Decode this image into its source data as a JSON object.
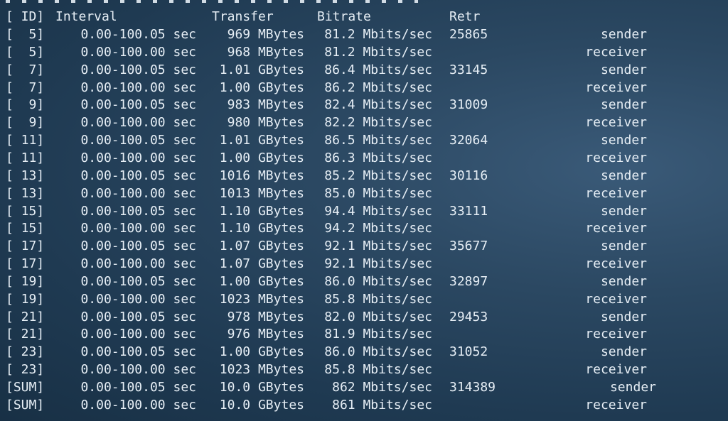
{
  "header": {
    "id": "[ ID]",
    "interval": "Interval",
    "transfer": "Transfer",
    "bitrate": "Bitrate",
    "retr": "Retr"
  },
  "rows": [
    {
      "id": "[  5]",
      "interval": "0.00-100.05 sec",
      "transfer": "969 MBytes",
      "bitrate": "81.2 Mbits/sec",
      "retr": "25865",
      "role": "sender"
    },
    {
      "id": "[  5]",
      "interval": "0.00-100.00 sec",
      "transfer": "968 MBytes",
      "bitrate": "81.2 Mbits/sec",
      "retr": "",
      "role": "receiver"
    },
    {
      "id": "[  7]",
      "interval": "0.00-100.05 sec",
      "transfer": "1.01 GBytes",
      "bitrate": "86.4 Mbits/sec",
      "retr": "33145",
      "role": "sender"
    },
    {
      "id": "[  7]",
      "interval": "0.00-100.00 sec",
      "transfer": "1.00 GBytes",
      "bitrate": "86.2 Mbits/sec",
      "retr": "",
      "role": "receiver"
    },
    {
      "id": "[  9]",
      "interval": "0.00-100.05 sec",
      "transfer": "983 MBytes",
      "bitrate": "82.4 Mbits/sec",
      "retr": "31009",
      "role": "sender"
    },
    {
      "id": "[  9]",
      "interval": "0.00-100.00 sec",
      "transfer": "980 MBytes",
      "bitrate": "82.2 Mbits/sec",
      "retr": "",
      "role": "receiver"
    },
    {
      "id": "[ 11]",
      "interval": "0.00-100.05 sec",
      "transfer": "1.01 GBytes",
      "bitrate": "86.5 Mbits/sec",
      "retr": "32064",
      "role": "sender"
    },
    {
      "id": "[ 11]",
      "interval": "0.00-100.00 sec",
      "transfer": "1.00 GBytes",
      "bitrate": "86.3 Mbits/sec",
      "retr": "",
      "role": "receiver"
    },
    {
      "id": "[ 13]",
      "interval": "0.00-100.05 sec",
      "transfer": "1016 MBytes",
      "bitrate": "85.2 Mbits/sec",
      "retr": "30116",
      "role": "sender"
    },
    {
      "id": "[ 13]",
      "interval": "0.00-100.00 sec",
      "transfer": "1013 MBytes",
      "bitrate": "85.0 Mbits/sec",
      "retr": "",
      "role": "receiver"
    },
    {
      "id": "[ 15]",
      "interval": "0.00-100.05 sec",
      "transfer": "1.10 GBytes",
      "bitrate": "94.4 Mbits/sec",
      "retr": "33111",
      "role": "sender"
    },
    {
      "id": "[ 15]",
      "interval": "0.00-100.00 sec",
      "transfer": "1.10 GBytes",
      "bitrate": "94.2 Mbits/sec",
      "retr": "",
      "role": "receiver"
    },
    {
      "id": "[ 17]",
      "interval": "0.00-100.05 sec",
      "transfer": "1.07 GBytes",
      "bitrate": "92.1 Mbits/sec",
      "retr": "35677",
      "role": "sender"
    },
    {
      "id": "[ 17]",
      "interval": "0.00-100.00 sec",
      "transfer": "1.07 GBytes",
      "bitrate": "92.1 Mbits/sec",
      "retr": "",
      "role": "receiver"
    },
    {
      "id": "[ 19]",
      "interval": "0.00-100.05 sec",
      "transfer": "1.00 GBytes",
      "bitrate": "86.0 Mbits/sec",
      "retr": "32897",
      "role": "sender"
    },
    {
      "id": "[ 19]",
      "interval": "0.00-100.00 sec",
      "transfer": "1023 MBytes",
      "bitrate": "85.8 Mbits/sec",
      "retr": "",
      "role": "receiver"
    },
    {
      "id": "[ 21]",
      "interval": "0.00-100.05 sec",
      "transfer": "978 MBytes",
      "bitrate": "82.0 Mbits/sec",
      "retr": "29453",
      "role": "sender"
    },
    {
      "id": "[ 21]",
      "interval": "0.00-100.00 sec",
      "transfer": "976 MBytes",
      "bitrate": "81.9 Mbits/sec",
      "retr": "",
      "role": "receiver"
    },
    {
      "id": "[ 23]",
      "interval": "0.00-100.05 sec",
      "transfer": "1.00 GBytes",
      "bitrate": "86.0 Mbits/sec",
      "retr": "31052",
      "role": "sender"
    },
    {
      "id": "[ 23]",
      "interval": "0.00-100.00 sec",
      "transfer": "1023 MBytes",
      "bitrate": "85.8 Mbits/sec",
      "retr": "",
      "role": "receiver"
    },
    {
      "id": "[SUM]",
      "interval": "0.00-100.05 sec",
      "transfer": "10.0 GBytes",
      "bitrate": "862 Mbits/sec",
      "retr": "314389",
      "role": "sender"
    },
    {
      "id": "[SUM]",
      "interval": "0.00-100.00 sec",
      "transfer": "10.0 GBytes",
      "bitrate": "861 Mbits/sec",
      "retr": "",
      "role": "receiver"
    }
  ]
}
